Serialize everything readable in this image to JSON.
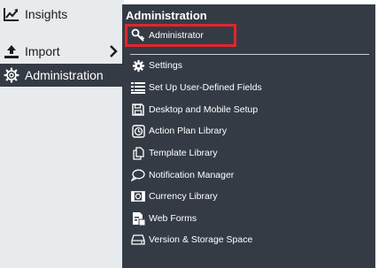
{
  "sidebar": {
    "items": [
      {
        "label": "Insights",
        "icon": "line-chart-icon"
      },
      {
        "label": "Import",
        "icon": "upload-icon"
      },
      {
        "label": "Administration",
        "icon": "gear-icon"
      }
    ]
  },
  "flyout": {
    "title": "Administration",
    "items": [
      {
        "label": "Administrator",
        "icon": "key-icon"
      },
      {
        "label": "Settings",
        "icon": "gear-icon"
      },
      {
        "label": "Set Up User-Defined Fields",
        "icon": "list-icon"
      },
      {
        "label": "Desktop and Mobile Setup",
        "icon": "floppy-icon"
      },
      {
        "label": "Action Plan Library",
        "icon": "clock-icon"
      },
      {
        "label": "Template Library",
        "icon": "copy-icon"
      },
      {
        "label": "Notification Manager",
        "icon": "speech-bubble-icon"
      },
      {
        "label": "Currency Library",
        "icon": "money-icon"
      },
      {
        "label": "Web Forms",
        "icon": "web-form-icon"
      },
      {
        "label": "Version & Storage Space",
        "icon": "hard-drive-icon"
      }
    ]
  },
  "colors": {
    "sidebar_bg": "#e7ebed",
    "flyout_bg": "#353b45",
    "highlight": "#e0262b"
  }
}
